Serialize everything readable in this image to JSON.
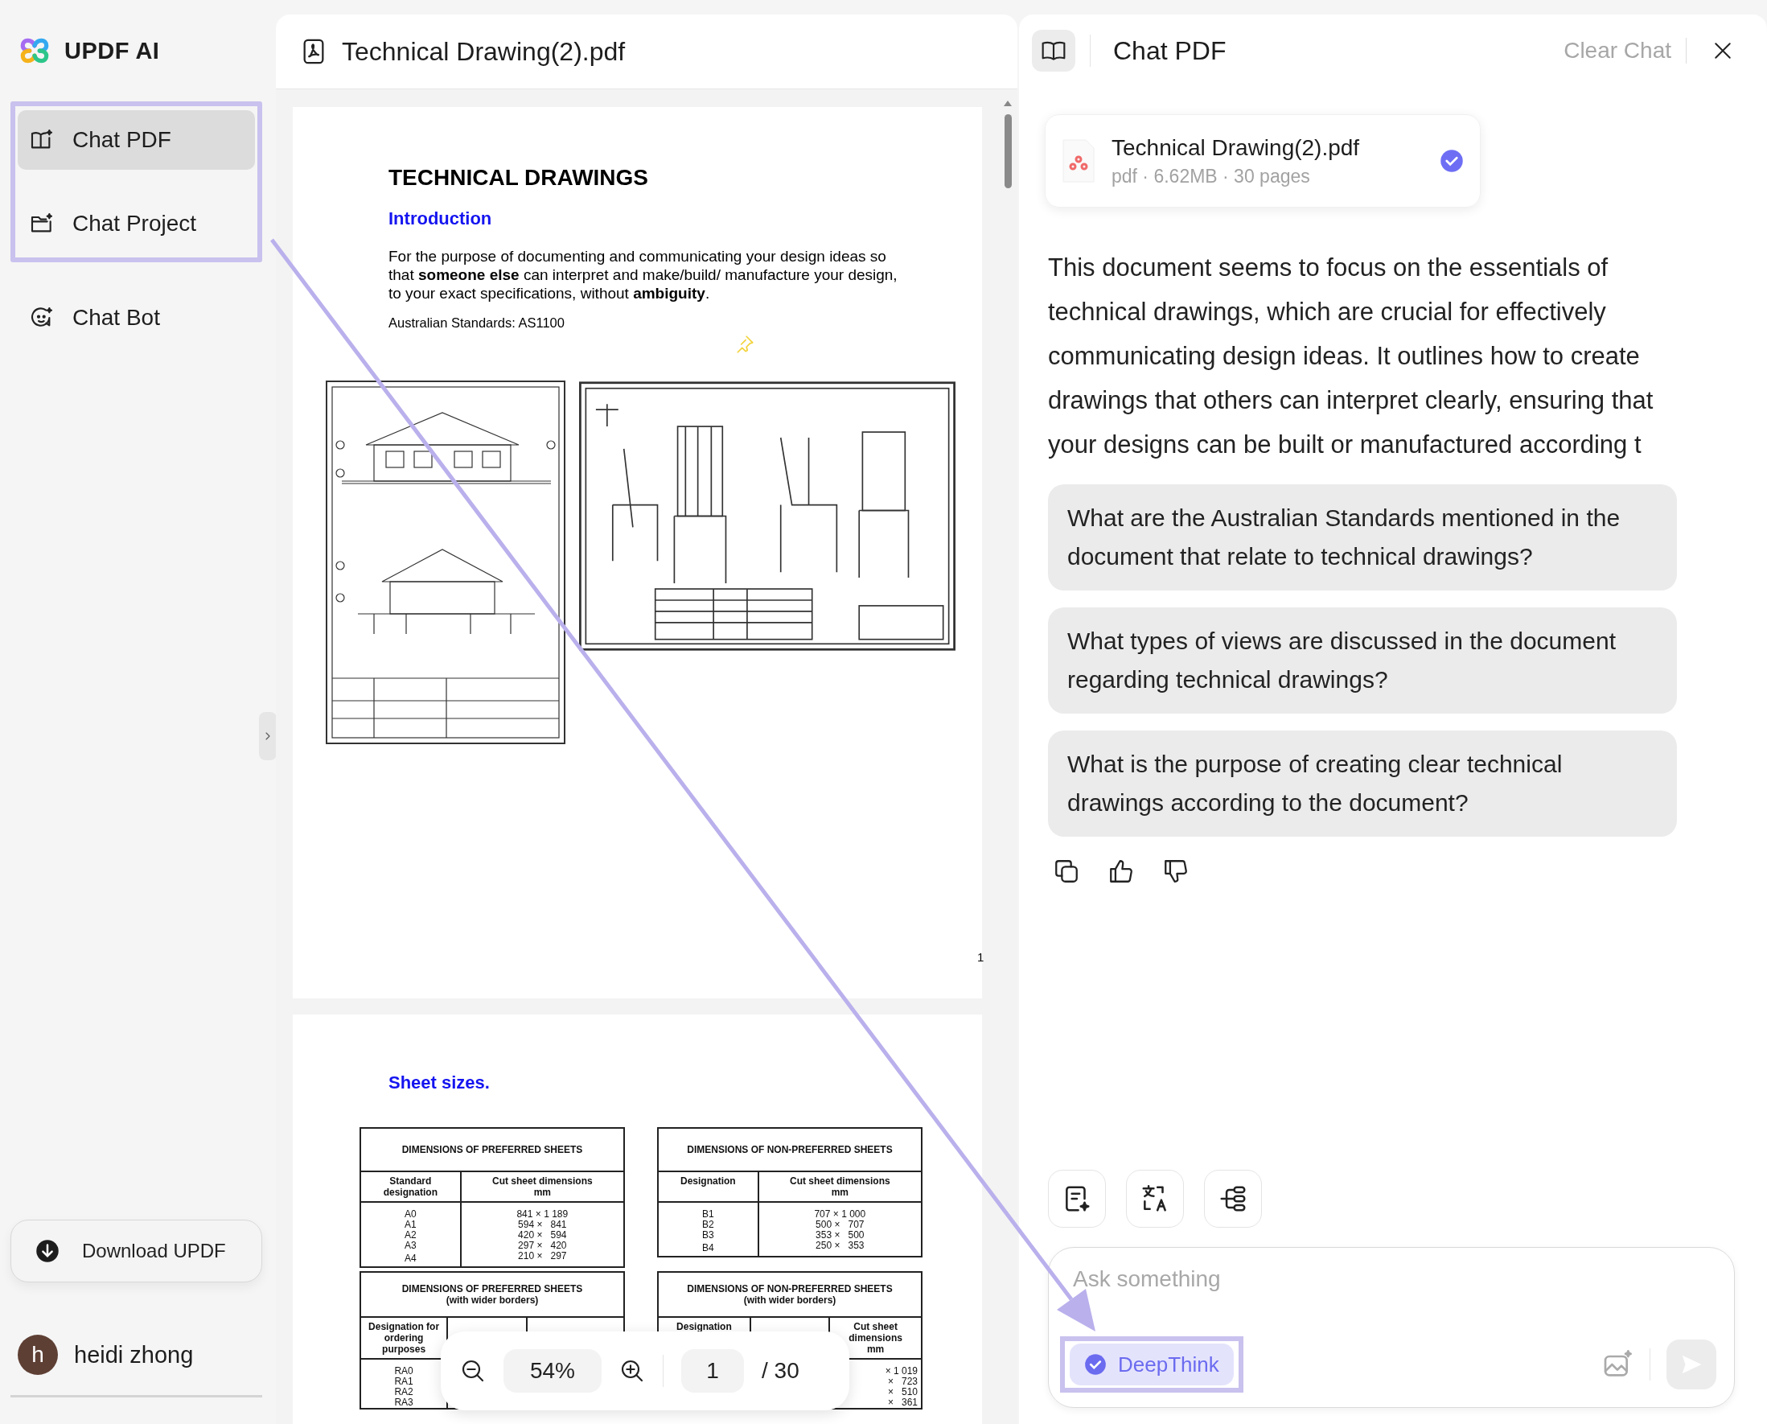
{
  "sidebar": {
    "brand": "UPDF AI",
    "items": [
      {
        "label": "Chat PDF",
        "selected": true,
        "kind": "book",
        "highlighted": true
      },
      {
        "label": "Chat Project",
        "selected": false,
        "kind": "folder",
        "highlighted": true
      },
      {
        "label": "Chat Bot",
        "selected": false,
        "kind": "bot"
      }
    ],
    "download": "Download UPDF",
    "user": {
      "initial": "h",
      "name": "heidi zhong"
    }
  },
  "pdf": {
    "title": "Technical Drawing(2).pdf",
    "page1": {
      "heading": "TECHNICAL DRAWINGS",
      "subheading": "Introduction",
      "paragraph": "For the purpose of documenting and communicating your design ideas so that **someone else** can interpret and make/build/ manufacture your design, to your exact specifications, without **ambiguity**.",
      "standards": "Australian Standards:  AS1100",
      "page_number": "1"
    },
    "page2": {
      "heading": "Sheet sizes.",
      "tables": [
        {
          "kind": "two-column",
          "title": "DIMENSIONS OF PREFERRED SHEETS",
          "headers": {
            "designation": "Standard designation",
            "dimensions": "Cut sheet dimensions",
            "unit": "mm"
          },
          "rows": [
            {
              "designation": "A0",
              "dimensions": "841 × 1 189"
            },
            {
              "designation": "A1",
              "dimensions": "594 ×   841"
            },
            {
              "designation": "A2",
              "dimensions": "420 ×   594"
            },
            {
              "designation": "A3",
              "dimensions": "297 ×   420"
            },
            {
              "designation": "A4",
              "dimensions": "210 ×   297"
            }
          ]
        },
        {
          "kind": "two-column",
          "title": "DIMENSIONS OF NON-PREFERRED SHEETS",
          "headers": {
            "designation": "Designation",
            "dimensions": "Cut sheet dimensions",
            "unit": "mm"
          },
          "rows": [
            {
              "designation": "B1",
              "dimensions": "707 × 1 000"
            },
            {
              "designation": "B2",
              "dimensions": "500 ×   707"
            },
            {
              "designation": "B3",
              "dimensions": "353 ×   500"
            },
            {
              "designation": "B4",
              "dimensions": "250 ×   353"
            }
          ]
        },
        {
          "kind": "three-column",
          "title": "DIMENSIONS OF PREFERRED SHEETS",
          "subtitle": "(with wider borders)",
          "headers": {
            "designation": "Designation for ordering purposes"
          },
          "rows": [
            {
              "designation": "RA0"
            },
            {
              "designation": "RA1"
            },
            {
              "designation": "RA2"
            },
            {
              "designation": "RA3"
            }
          ]
        },
        {
          "kind": "three-column",
          "title": "DIMENSIONS OF NON-PREFERRED SHEETS",
          "subtitle": "(with wider borders)",
          "headers": {
            "designation": "Designation",
            "dimensions": "Cut sheet dimensions",
            "unit": "mm"
          },
          "rows": [
            {
              "dimensions": "× 1 019"
            },
            {
              "dimensions": "×   723"
            },
            {
              "dimensions": "×   510"
            },
            {
              "dimensions": "×   361"
            }
          ]
        }
      ]
    }
  },
  "zoom_bar": {
    "zoom": "54%",
    "page": "1",
    "total": "/ 30"
  },
  "chat": {
    "title": "Chat PDF",
    "clear": "Clear Chat",
    "file": {
      "name": "Technical Drawing(2).pdf",
      "meta": "pdf · 6.62MB · 30 pages",
      "selected": true
    },
    "answer": "This document seems to focus on the essentials of technical drawings, which are crucial for effectively communicating design ideas. It outlines how to create drawings that others can interpret clearly, ensuring that your designs can be built or manufactured according t",
    "suggestions": [
      "What are the Australian Standards mentioned in the document that relate to technical drawings?",
      "What types of views are discussed in the document regarding technical drawings?",
      "What is the purpose of creating clear technical drawings according to the document?"
    ],
    "input": {
      "placeholder": "Ask something"
    },
    "deepthink": {
      "label": "DeepThink",
      "checked": true
    }
  }
}
